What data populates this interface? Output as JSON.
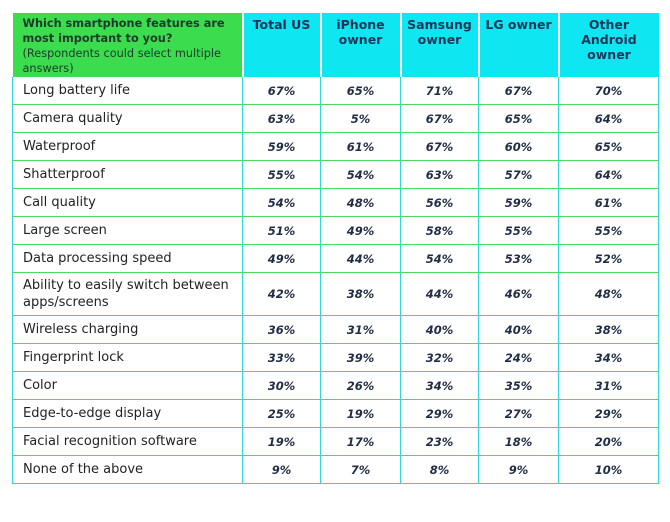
{
  "header": {
    "question_bold": "Which smartphone features are most important to you?",
    "question_note": "(Respondents could select multiple answers)",
    "columns": [
      "Total US",
      "iPhone owner",
      "Samsung owner",
      "LG owner",
      "Other Android owner"
    ]
  },
  "rows": [
    {
      "feature": "Long battery life",
      "values": [
        "67%",
        "65%",
        "71%",
        "67%",
        "70%"
      ]
    },
    {
      "feature": "Camera quality",
      "values": [
        "63%",
        "5%",
        "67%",
        "65%",
        "64%"
      ]
    },
    {
      "feature": "Waterproof",
      "values": [
        "59%",
        "61%",
        "67%",
        "60%",
        "65%"
      ]
    },
    {
      "feature": "Shatterproof",
      "values": [
        "55%",
        "54%",
        "63%",
        "57%",
        "64%"
      ]
    },
    {
      "feature": "Call quality",
      "values": [
        "54%",
        "48%",
        "56%",
        "59%",
        "61%"
      ]
    },
    {
      "feature": "Large screen",
      "values": [
        "51%",
        "49%",
        "58%",
        "55%",
        "55%"
      ]
    },
    {
      "feature": "Data processing speed",
      "values": [
        "49%",
        "44%",
        "54%",
        "53%",
        "52%"
      ]
    },
    {
      "feature": "Ability to easily switch between apps/screens",
      "values": [
        "42%",
        "38%",
        "44%",
        "46%",
        "48%"
      ]
    },
    {
      "feature": "Wireless charging",
      "values": [
        "36%",
        "31%",
        "40%",
        "40%",
        "38%"
      ]
    },
    {
      "feature": "Fingerprint lock",
      "values": [
        "33%",
        "39%",
        "32%",
        "24%",
        "34%"
      ]
    },
    {
      "feature": "Color",
      "values": [
        "30%",
        "26%",
        "34%",
        "35%",
        "31%"
      ]
    },
    {
      "feature": "Edge-to-edge display",
      "values": [
        "25%",
        "19%",
        "29%",
        "27%",
        "29%"
      ]
    },
    {
      "feature": "Facial recognition software",
      "values": [
        "19%",
        "17%",
        "23%",
        "18%",
        "20%"
      ]
    },
    {
      "feature": "None of the above",
      "values": [
        "9%",
        "7%",
        "8%",
        "9%",
        "10%"
      ]
    }
  ],
  "colors": {
    "question_header_bg": "#3bdc4e",
    "column_header_bg": "#0ee6f2",
    "row_divider": "#4cd964",
    "column_divider": "#30d5e0"
  }
}
